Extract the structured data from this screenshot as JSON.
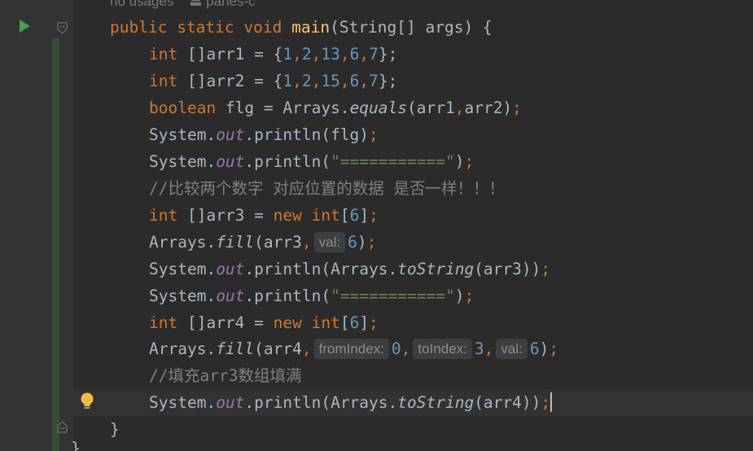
{
  "header_hint": {
    "usages": "no usages",
    "author": "panes-c"
  },
  "code": {
    "main_sig": {
      "public": "public",
      "static": "static",
      "void": "void",
      "name": "main",
      "params": "(String[] args) {"
    },
    "l1": {
      "kw": "int",
      "decl": " []arr1 = {",
      "n1": "1",
      "n2": "2",
      "n3": "13",
      "n4": "6",
      "n5": "7",
      "end": "};"
    },
    "l2": {
      "kw": "int",
      "decl": " []arr2 = {",
      "n1": "1",
      "n2": "2",
      "n3": "15",
      "n4": "6",
      "n5": "7",
      "end": "};"
    },
    "l3": {
      "kw": "boolean",
      "decl": " flg = Arrays.",
      "method": "equals",
      "args": "(arr1",
      "args2": "arr2)",
      "end": ";"
    },
    "l4": {
      "sys": "System.",
      "field": "out",
      "call": ".println(flg)",
      "end": ";"
    },
    "l5": {
      "sys": "System.",
      "field": "out",
      "call": ".println(",
      "str": "\"===========\"",
      "close": ")",
      "end": ";"
    },
    "l6": {
      "comment": "//比较两个数字 对应位置的数据 是否一样！！！"
    },
    "l7": {
      "kw": "int",
      "decl": " []arr3 = ",
      "new": "new",
      "kw2": "int",
      "idx": "[",
      "n": "6",
      "close": "]",
      "end": ";"
    },
    "l8": {
      "cls": "Arrays.",
      "method": "fill",
      "args": "(arr3",
      "hint": "val:",
      "n": "6",
      "close": ")",
      "end": ";"
    },
    "l9": {
      "sys": "System.",
      "field": "out",
      "call": ".println(Arrays.",
      "method": "toString",
      "args": "(arr3))",
      "end": ";"
    },
    "l10": {
      "sys": "System.",
      "field": "out",
      "call": ".println(",
      "str": "\"===========\"",
      "close": ")",
      "end": ";"
    },
    "l11": {
      "kw": "int",
      "decl": " []arr4 = ",
      "new": "new",
      "kw2": "int",
      "idx": "[",
      "n": "6",
      "close": "]",
      "end": ";"
    },
    "l12": {
      "cls": "Arrays.",
      "method": "fill",
      "args": "(arr4",
      "hint1": "fromIndex:",
      "n1": "0",
      "hint2": "toIndex:",
      "n2": "3",
      "hint3": "val:",
      "n3": "6",
      "close": ")",
      "end": ";"
    },
    "l13": {
      "comment": "//填充arr3数组填满"
    },
    "l14": {
      "sys": "System.",
      "field": "out",
      "call": ".println(Arrays.",
      "method": "toString",
      "args": "(arr4))",
      "end": ";"
    },
    "l15": {
      "brace": "}"
    },
    "l16": {
      "brace": "}"
    }
  },
  "colors": {
    "background": "#2b2b2b",
    "keyword": "#cc7832",
    "function": "#ffc66d",
    "number": "#6897bb",
    "string": "#6a8759",
    "field": "#9876aa",
    "comment": "#808080"
  },
  "icons": {
    "run": "run-gutter-icon",
    "fold": "fold-marker-icon",
    "intention": "lightbulb-icon"
  }
}
